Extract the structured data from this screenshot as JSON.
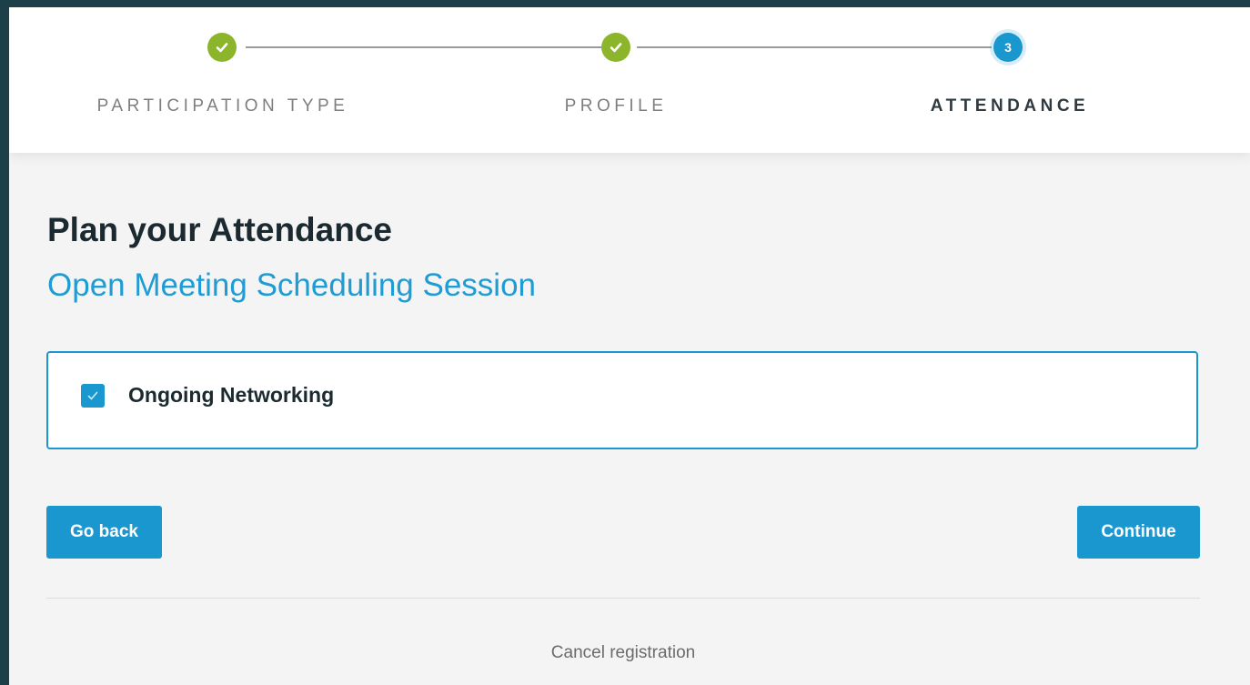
{
  "stepper": {
    "steps": [
      {
        "label": "PARTICIPATION TYPE",
        "status": "completed"
      },
      {
        "label": "PROFILE",
        "status": "completed"
      },
      {
        "label": "ATTENDANCE",
        "status": "current",
        "number": "3"
      }
    ]
  },
  "main": {
    "title": "Plan your Attendance",
    "session_title": "Open Meeting Scheduling Session",
    "options": [
      {
        "label": "Ongoing Networking",
        "checked": true
      }
    ]
  },
  "actions": {
    "back_label": "Go back",
    "continue_label": "Continue",
    "cancel_label": "Cancel registration"
  },
  "colors": {
    "accent": "#1a97cf",
    "completed": "#8db52b",
    "background": "#f4f4f4",
    "frame": "#1d3f4a"
  },
  "icons": {
    "completed_step": "check-icon",
    "checkbox": "checkmark-icon"
  }
}
